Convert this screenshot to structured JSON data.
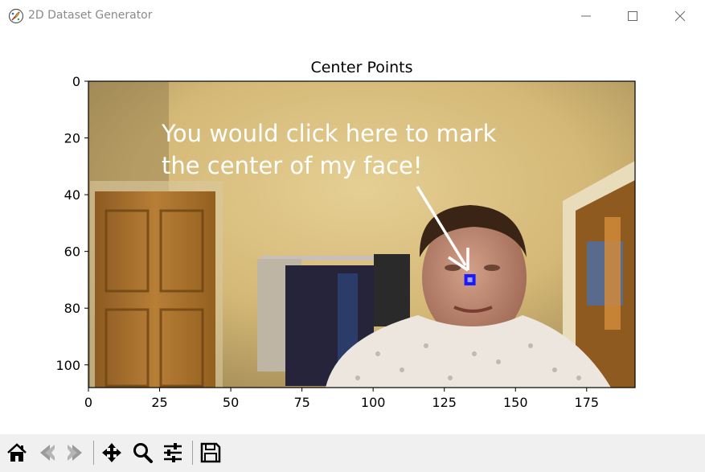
{
  "window": {
    "title": "2D Dataset Generator",
    "icon": "feather-icon"
  },
  "window_controls": {
    "minimize_icon": "minimize-icon",
    "maximize_icon": "maximize-icon",
    "close_icon": "close-icon"
  },
  "chart_data": {
    "type": "image",
    "title": "Center Points",
    "xlabel": "",
    "ylabel": "",
    "xlim": [
      0,
      192
    ],
    "ylim": [
      108,
      0
    ],
    "x_ticks": [
      0,
      25,
      50,
      75,
      100,
      125,
      150,
      175
    ],
    "y_ticks": [
      0,
      20,
      40,
      60,
      80,
      100
    ],
    "points": [
      {
        "x": 134,
        "y": 70
      }
    ],
    "marker_color": "#1a1aff",
    "annotation": {
      "lines": [
        "You would click here to mark",
        "the center of my face!"
      ],
      "color": "#ffffff"
    }
  },
  "toolbar": {
    "buttons": [
      {
        "name": "home-icon"
      },
      {
        "name": "back-icon"
      },
      {
        "name": "forward-icon"
      },
      {
        "name": "pan-icon"
      },
      {
        "name": "zoom-icon"
      },
      {
        "name": "configure-subplots-icon"
      },
      {
        "name": "save-icon"
      }
    ]
  }
}
